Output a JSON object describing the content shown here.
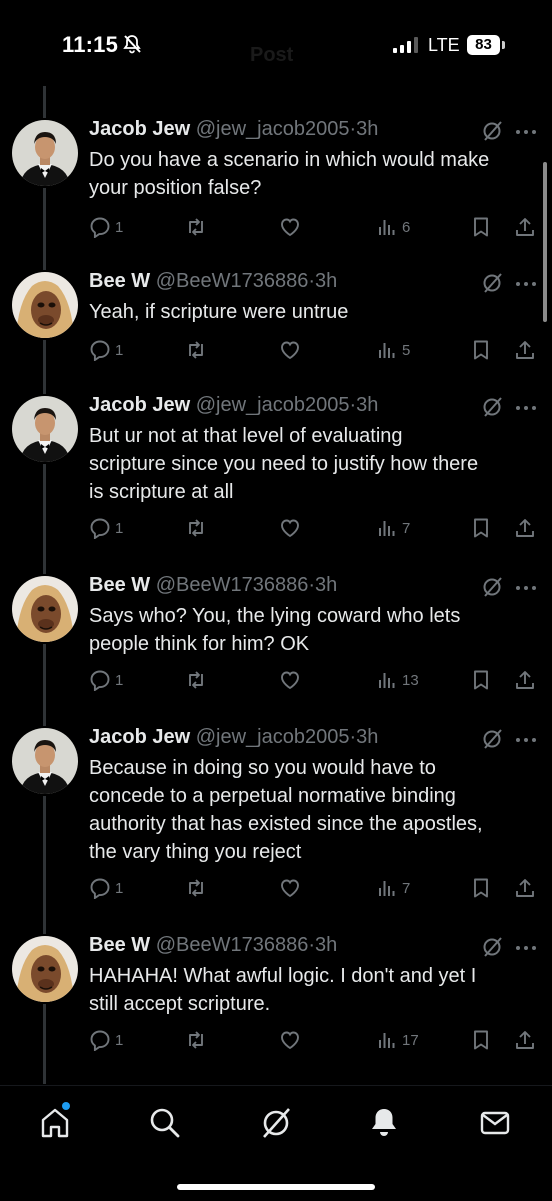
{
  "status_bar": {
    "time": "11:15",
    "network": "LTE",
    "battery": "83",
    "header_ghost": "Post"
  },
  "colors": {
    "background": "#000000",
    "text": "#e7e9ea",
    "muted": "#71767b",
    "accent": "#1d9bf0",
    "thread_line": "#2f3336"
  },
  "tweets": [
    {
      "name": "Jacob Jew",
      "handle": "@jew_jacob2005",
      "sep": "·",
      "time": "3h",
      "lines": [
        "Do you have a scenario in which would make",
        "your position false?"
      ],
      "replies": "1",
      "views": "6",
      "avatar": "tuxedo"
    },
    {
      "name": "Bee W",
      "handle": "@BeeW1736886",
      "sep": "·",
      "time": "3h",
      "lines": [
        "Yeah, if scripture were untrue"
      ],
      "replies": "1",
      "views": "5",
      "avatar": "ape"
    },
    {
      "name": "Jacob Jew",
      "handle": "@jew_jacob2005",
      "sep": "·",
      "time": "3h",
      "lines": [
        "But ur not at that level of evaluating",
        "scripture since you need to justify how there",
        "is scripture at all"
      ],
      "replies": "1",
      "views": "7",
      "avatar": "tuxedo"
    },
    {
      "name": "Bee W",
      "handle": "@BeeW1736886",
      "sep": "·",
      "time": "3h",
      "lines": [
        "Says who? You, the lying coward who lets",
        "people think for him? OK"
      ],
      "replies": "1",
      "views": "13",
      "avatar": "ape"
    },
    {
      "name": "Jacob Jew",
      "handle": "@jew_jacob2005",
      "sep": "·",
      "time": "3h",
      "lines": [
        "Because in doing so you would have to",
        "concede to a perpetual normative binding",
        "authority that has existed since the apostles,",
        "the vary thing you reject"
      ],
      "replies": "1",
      "views": "7",
      "avatar": "tuxedo"
    },
    {
      "name": "Bee W",
      "handle": "@BeeW1736886",
      "sep": "·",
      "time": "3h",
      "lines": [
        "HAHAHA! What awful logic. I don't and yet I",
        "still accept scripture."
      ],
      "replies": "1",
      "views": "17",
      "avatar": "ape"
    }
  ],
  "bottom_nav": {
    "items": [
      "home-icon",
      "search-icon",
      "grok-icon",
      "notifications-icon",
      "messages-icon"
    ]
  }
}
